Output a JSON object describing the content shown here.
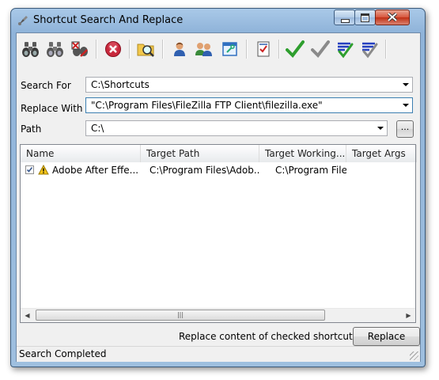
{
  "window": {
    "title": "Shortcut Search And Replace"
  },
  "toolbar": {
    "buttons": [
      {
        "name": "search-icon",
        "tooltip": ""
      },
      {
        "name": "search-next-icon"
      },
      {
        "name": "stop-search-icon"
      },
      {
        "name": "cancel-icon"
      },
      {
        "name": "browse-folder-icon"
      },
      {
        "name": "user-icon"
      },
      {
        "name": "all-users-icon"
      },
      {
        "name": "properties-icon"
      },
      {
        "name": "checklist-icon"
      },
      {
        "name": "check-all-icon"
      },
      {
        "name": "check-gray-icon"
      },
      {
        "name": "filter-check-icon"
      },
      {
        "name": "filter-uncheck-icon"
      }
    ]
  },
  "form": {
    "search_label": "Search For",
    "search_value": "C:\\Shortcuts",
    "replace_label": "Replace With",
    "replace_value": "\"C:\\Program Files\\FileZilla FTP Client\\filezilla.exe\"",
    "path_label": "Path",
    "path_value": "C:\\",
    "browse_label": "..."
  },
  "table": {
    "columns": [
      "Name",
      "Target Path",
      "Target Working...",
      "Target Args"
    ],
    "rows": [
      {
        "checked": true,
        "name": "Adobe After Effe...",
        "target_path": "C:\\Program Files\\Adob...",
        "target_working": "C:\\Program File...",
        "target_args": ""
      }
    ]
  },
  "actions": {
    "replace_hint": "Replace content of checked shortcuts",
    "replace_button": "Replace"
  },
  "status": {
    "text": "Search Completed"
  },
  "colors": {
    "accent_green": "#2e9e2e",
    "cancel_red": "#c8283c",
    "title_bar": "#9ebfdf"
  }
}
